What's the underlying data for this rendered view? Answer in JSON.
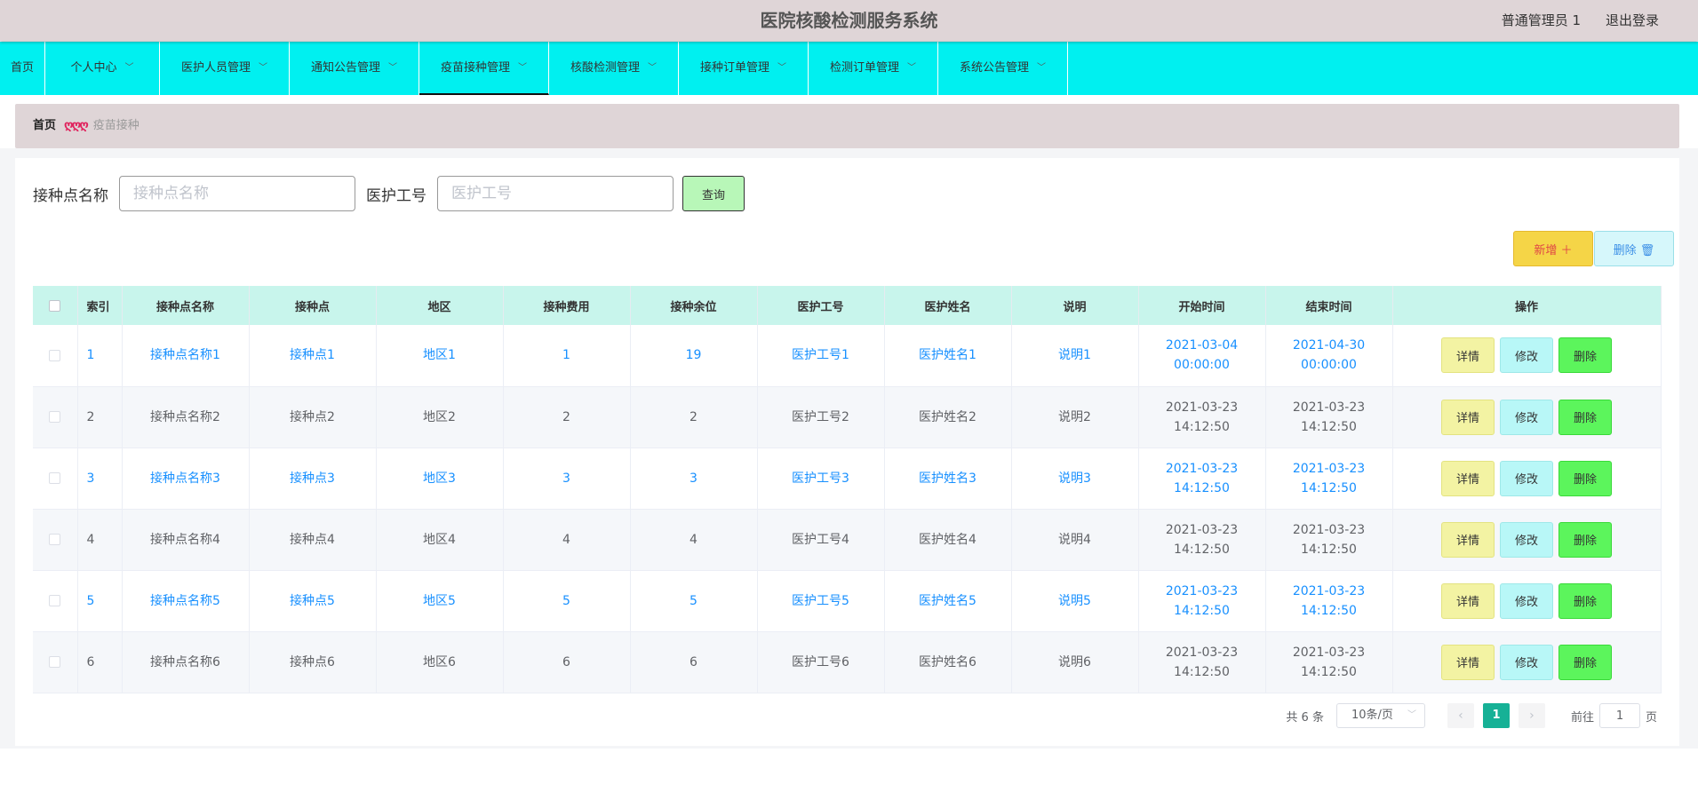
{
  "header": {
    "title": "医院核酸检测服务系统",
    "user": "普通管理员 1",
    "logout": "退出登录"
  },
  "nav": {
    "items": [
      {
        "label": "首页",
        "dropdown": false
      },
      {
        "label": "个人中心",
        "dropdown": true
      },
      {
        "label": "医护人员管理",
        "dropdown": true
      },
      {
        "label": "通知公告管理",
        "dropdown": true
      },
      {
        "label": "疫苗接种管理",
        "dropdown": true,
        "active": true
      },
      {
        "label": "核酸检测管理",
        "dropdown": true
      },
      {
        "label": "接种订单管理",
        "dropdown": true
      },
      {
        "label": "检测订单管理",
        "dropdown": true
      },
      {
        "label": "系统公告管理",
        "dropdown": true
      }
    ]
  },
  "breadcrumb": {
    "home": "首页",
    "separator": "ღღღ",
    "current": "疫苗接种"
  },
  "search": {
    "name_label": "接种点名称",
    "name_placeholder": "接种点名称",
    "name_value": "",
    "staff_label": "医护工号",
    "staff_placeholder": "医护工号",
    "staff_value": "",
    "query_button": "查询"
  },
  "actions": {
    "add": "新增 ＋",
    "delete": "删除 🗑"
  },
  "table": {
    "columns": [
      "索引",
      "接种点名称",
      "接种点",
      "地区",
      "接种费用",
      "接种余位",
      "医护工号",
      "医护姓名",
      "说明",
      "开始时间",
      "结束时间",
      "操作"
    ],
    "rows": [
      {
        "index": "1",
        "name": "接种点名称1",
        "point": "接种点1",
        "area": "地区1",
        "fee": "1",
        "remaining": "19",
        "staff_no": "医护工号1",
        "staff_name": "医护姓名1",
        "note": "说明1",
        "start": "2021-03-04 00:00:00",
        "end": "2021-04-30 00:00:00"
      },
      {
        "index": "2",
        "name": "接种点名称2",
        "point": "接种点2",
        "area": "地区2",
        "fee": "2",
        "remaining": "2",
        "staff_no": "医护工号2",
        "staff_name": "医护姓名2",
        "note": "说明2",
        "start": "2021-03-23 14:12:50",
        "end": "2021-03-23 14:12:50"
      },
      {
        "index": "3",
        "name": "接种点名称3",
        "point": "接种点3",
        "area": "地区3",
        "fee": "3",
        "remaining": "3",
        "staff_no": "医护工号3",
        "staff_name": "医护姓名3",
        "note": "说明3",
        "start": "2021-03-23 14:12:50",
        "end": "2021-03-23 14:12:50"
      },
      {
        "index": "4",
        "name": "接种点名称4",
        "point": "接种点4",
        "area": "地区4",
        "fee": "4",
        "remaining": "4",
        "staff_no": "医护工号4",
        "staff_name": "医护姓名4",
        "note": "说明4",
        "start": "2021-03-23 14:12:50",
        "end": "2021-03-23 14:12:50"
      },
      {
        "index": "5",
        "name": "接种点名称5",
        "point": "接种点5",
        "area": "地区5",
        "fee": "5",
        "remaining": "5",
        "staff_no": "医护工号5",
        "staff_name": "医护姓名5",
        "note": "说明5",
        "start": "2021-03-23 14:12:50",
        "end": "2021-03-23 14:12:50"
      },
      {
        "index": "6",
        "name": "接种点名称6",
        "point": "接种点6",
        "area": "地区6",
        "fee": "6",
        "remaining": "6",
        "staff_no": "医护工号6",
        "staff_name": "医护姓名6",
        "note": "说明6",
        "start": "2021-03-23 14:12:50",
        "end": "2021-03-23 14:12:50"
      }
    ],
    "op_detail": "详情",
    "op_edit": "修改",
    "op_delete": "删除"
  },
  "pagination": {
    "total": "共 6 条",
    "page_size": "10条/页",
    "current_page": "1",
    "goto_label": "前往",
    "goto_value": "1",
    "page_unit": "页"
  },
  "colors": {
    "nav_bg": "#00f0f0",
    "header_bg": "#dfd5d7",
    "table_header_bg": "#c8f5ec",
    "link_blue": "#1890ff",
    "page_active": "#16b196"
  }
}
